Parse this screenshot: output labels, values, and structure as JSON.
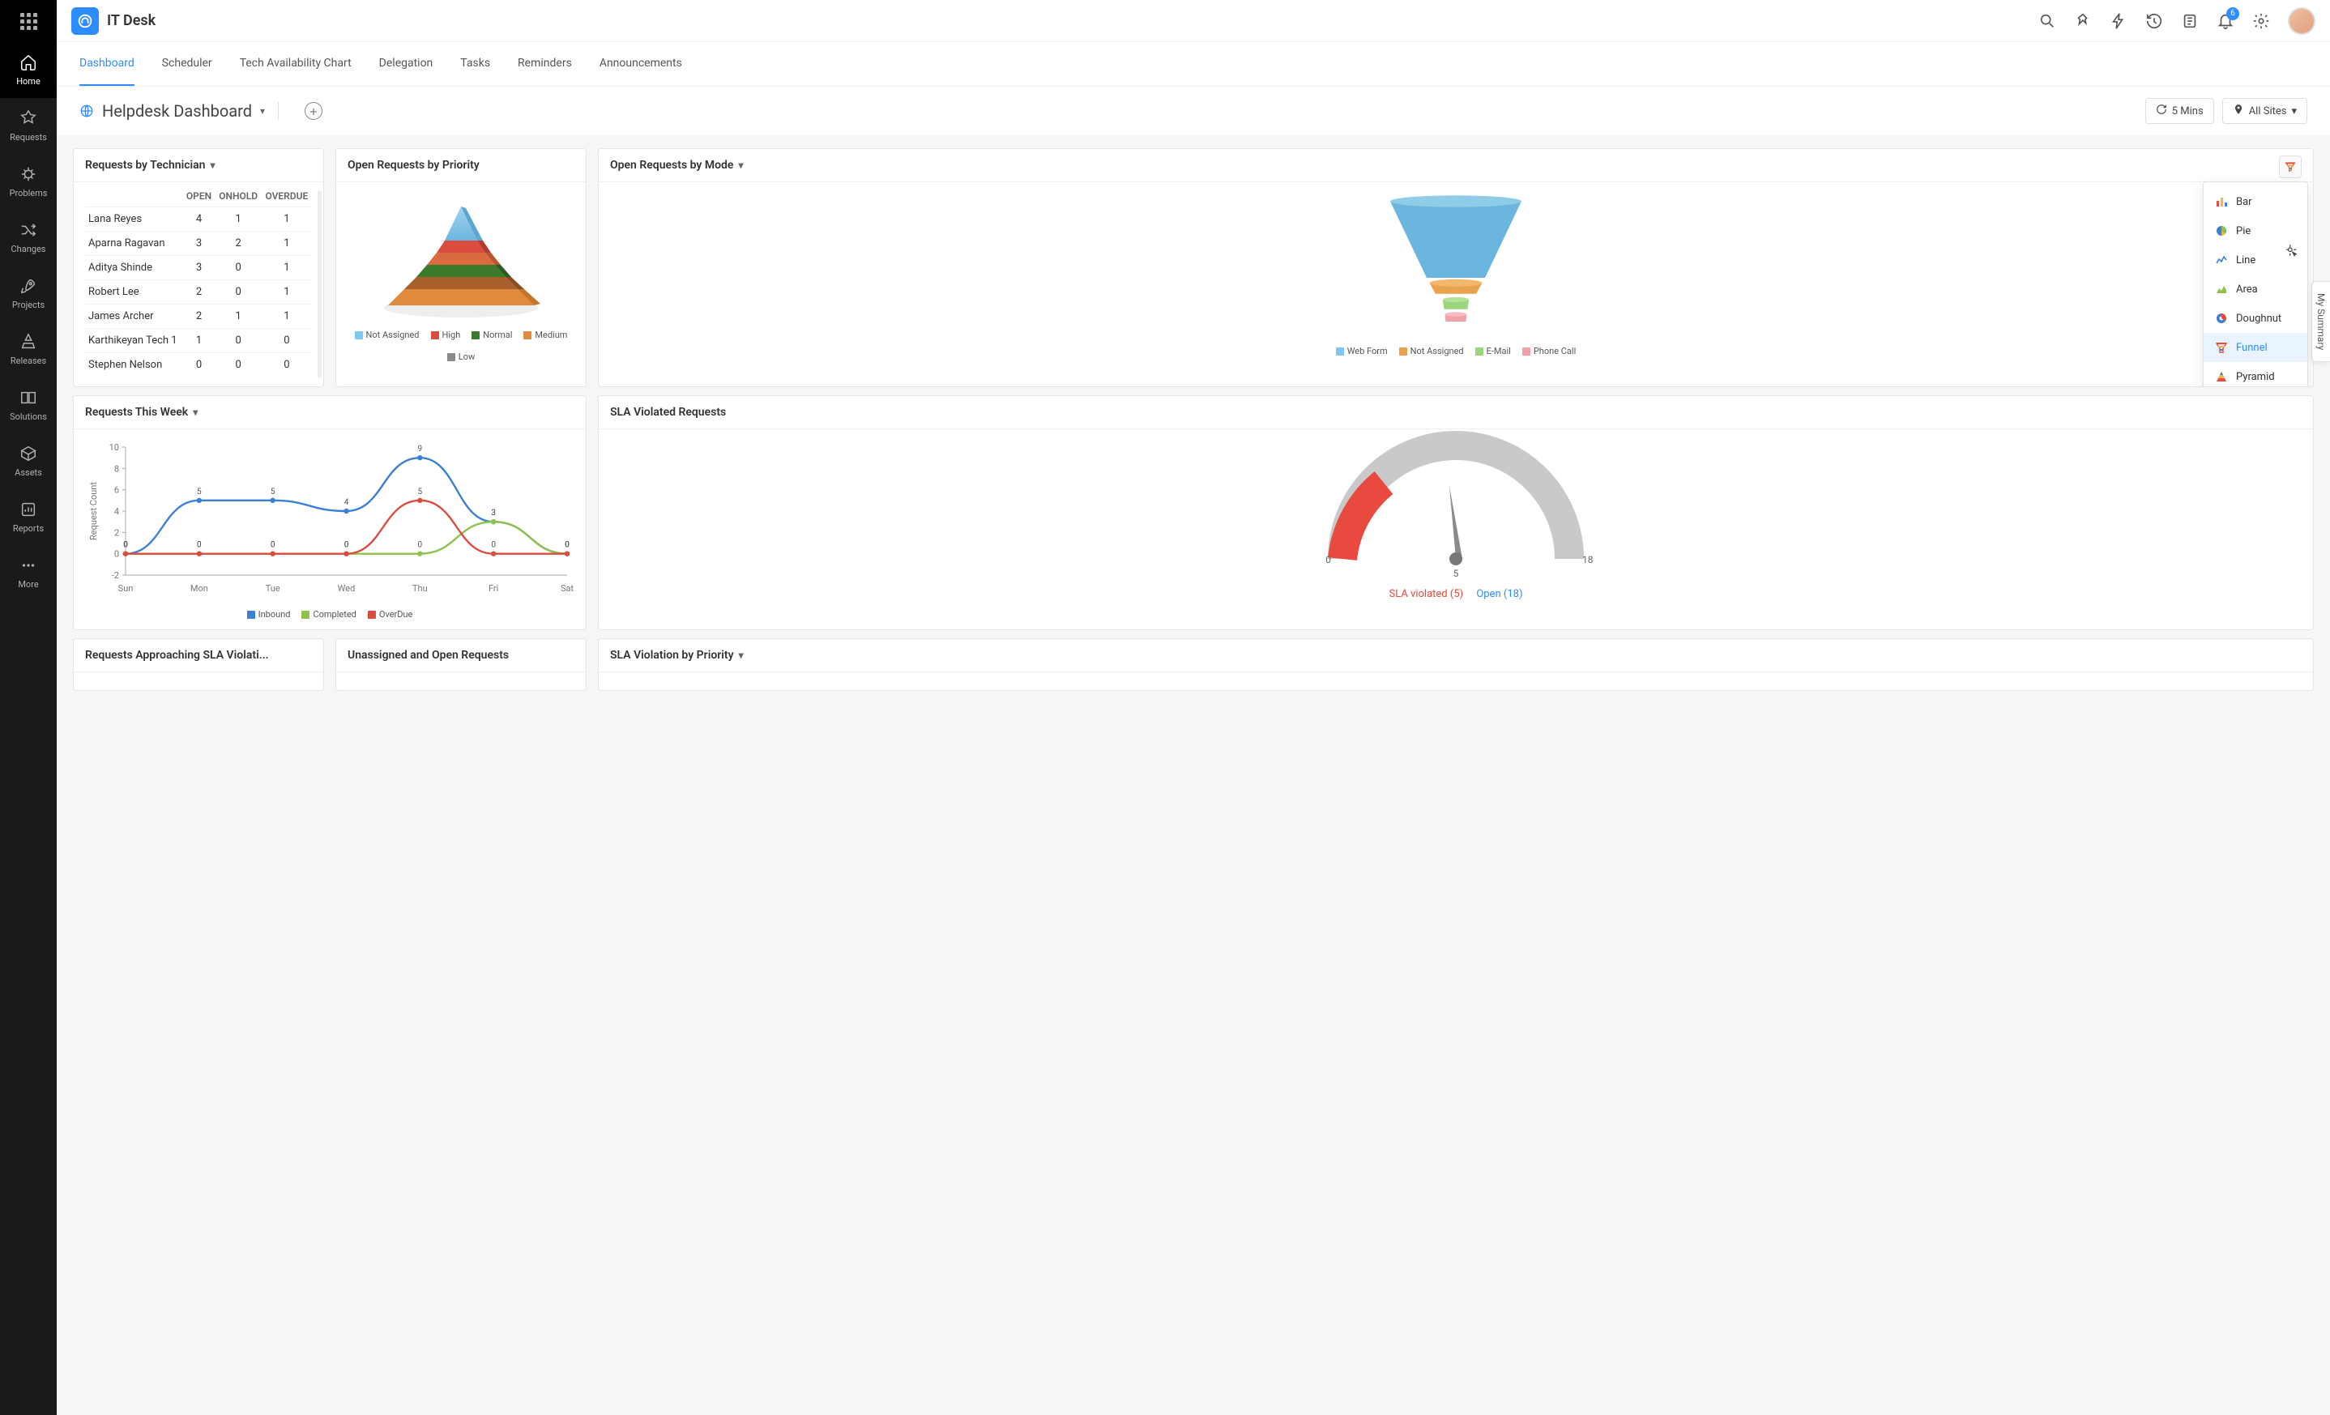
{
  "app": {
    "title": "IT Desk"
  },
  "notif_count": "6",
  "sidebar": {
    "items": [
      {
        "label": "Home",
        "active": true
      },
      {
        "label": "Requests"
      },
      {
        "label": "Problems"
      },
      {
        "label": "Changes"
      },
      {
        "label": "Projects"
      },
      {
        "label": "Releases"
      },
      {
        "label": "Solutions"
      },
      {
        "label": "Assets"
      },
      {
        "label": "Reports"
      },
      {
        "label": "More"
      }
    ]
  },
  "subnav": {
    "items": [
      {
        "label": "Dashboard",
        "active": true
      },
      {
        "label": "Scheduler"
      },
      {
        "label": "Tech Availability Chart"
      },
      {
        "label": "Delegation"
      },
      {
        "label": "Tasks"
      },
      {
        "label": "Reminders"
      },
      {
        "label": "Announcements"
      }
    ]
  },
  "dash": {
    "title": "Helpdesk Dashboard",
    "refresh": "5 Mins",
    "sites": "All Sites",
    "my_summary_label": "My Summary"
  },
  "cards": {
    "tech": {
      "title": "Requests by Technician"
    },
    "priority": {
      "title": "Open Requests by Priority"
    },
    "mode": {
      "title": "Open Requests by Mode"
    },
    "week": {
      "title": "Requests This Week"
    },
    "sla": {
      "title": "SLA Violated Requests"
    },
    "approaching": {
      "title": "Requests Approaching SLA Violati..."
    },
    "unassigned": {
      "title": "Unassigned and Open Requests"
    },
    "slaprio": {
      "title": "SLA Violation by Priority"
    }
  },
  "tech_table": {
    "cols": [
      "OPEN",
      "ONHOLD",
      "OVERDUE"
    ],
    "rows": [
      {
        "name": "Lana Reyes",
        "open": "4",
        "onhold": "1",
        "overdue": "1",
        "odred": true
      },
      {
        "name": "Aparna Ragavan",
        "open": "3",
        "onhold": "2",
        "overdue": "1",
        "odred": true
      },
      {
        "name": "Aditya Shinde",
        "open": "3",
        "onhold": "0",
        "overdue": "1",
        "odred": true
      },
      {
        "name": "Robert Lee",
        "open": "2",
        "onhold": "0",
        "overdue": "1",
        "odred": true
      },
      {
        "name": "James Archer",
        "open": "2",
        "onhold": "1",
        "overdue": "1",
        "odred": true
      },
      {
        "name": "Karthikeyan Tech 1",
        "open": "1",
        "onhold": "0",
        "overdue": "0",
        "odred": false
      },
      {
        "name": "Stephen Nelson",
        "open": "0",
        "onhold": "0",
        "overdue": "0",
        "odred": false
      }
    ]
  },
  "priority_legend": [
    {
      "label": "Not Assigned",
      "color": "#7ec7f0"
    },
    {
      "label": "High",
      "color": "#d94c3e"
    },
    {
      "label": "Normal",
      "color": "#3b7a2b"
    },
    {
      "label": "Medium",
      "color": "#e08a3e"
    },
    {
      "label": "Low",
      "color": "#8a8a8a"
    }
  ],
  "mode_legend": [
    {
      "label": "Web Form",
      "color": "#7ec7f0"
    },
    {
      "label": "Not Assigned",
      "color": "#e9a24e"
    },
    {
      "label": "E-Mail",
      "color": "#9ad67c"
    },
    {
      "label": "Phone Call",
      "color": "#f4a0a8"
    }
  ],
  "chart_menu": {
    "items": [
      {
        "label": "Bar"
      },
      {
        "label": "Pie"
      },
      {
        "label": "Line"
      },
      {
        "label": "Area"
      },
      {
        "label": "Doughnut"
      },
      {
        "label": "Funnel",
        "active": true
      },
      {
        "label": "Pyramid"
      }
    ]
  },
  "week_legend": [
    {
      "label": "Inbound",
      "color": "#3b7fd6"
    },
    {
      "label": "Completed",
      "color": "#8fc24a"
    },
    {
      "label": "OverDue",
      "color": "#d94c3e"
    }
  ],
  "week_ylabel": "Request Count",
  "sla_summary": {
    "violated_label": "SLA violated",
    "violated_count": "5",
    "open_label": "Open",
    "open_count": "18",
    "axis_min": "0",
    "axis_mid": "5",
    "axis_max": "18"
  },
  "chart_data": [
    {
      "id": "requests_this_week",
      "type": "line",
      "categories": [
        "Sun",
        "Mon",
        "Tue",
        "Wed",
        "Thu",
        "Fri",
        "Sat"
      ],
      "yticks": [
        -2,
        0,
        2,
        4,
        6,
        8,
        10
      ],
      "ylabel": "Request Count",
      "series": [
        {
          "name": "Inbound",
          "values": [
            0,
            5,
            5,
            4,
            9,
            3,
            0
          ],
          "color": "#3b7fd6"
        },
        {
          "name": "Completed",
          "values": [
            0,
            0,
            0,
            0,
            0,
            3,
            0
          ],
          "color": "#8fc24a"
        },
        {
          "name": "OverDue",
          "values": [
            0,
            0,
            0,
            0,
            5,
            0,
            0
          ],
          "color": "#d94c3e"
        }
      ]
    },
    {
      "id": "sla_gauge",
      "type": "gauge",
      "value": 5,
      "max": 18,
      "min": 0,
      "segments": [
        {
          "label": "SLA violated",
          "value": 5,
          "color": "#e84a3f"
        },
        {
          "label": "Open",
          "value": 18,
          "color": "#c9c9c9"
        }
      ]
    }
  ]
}
